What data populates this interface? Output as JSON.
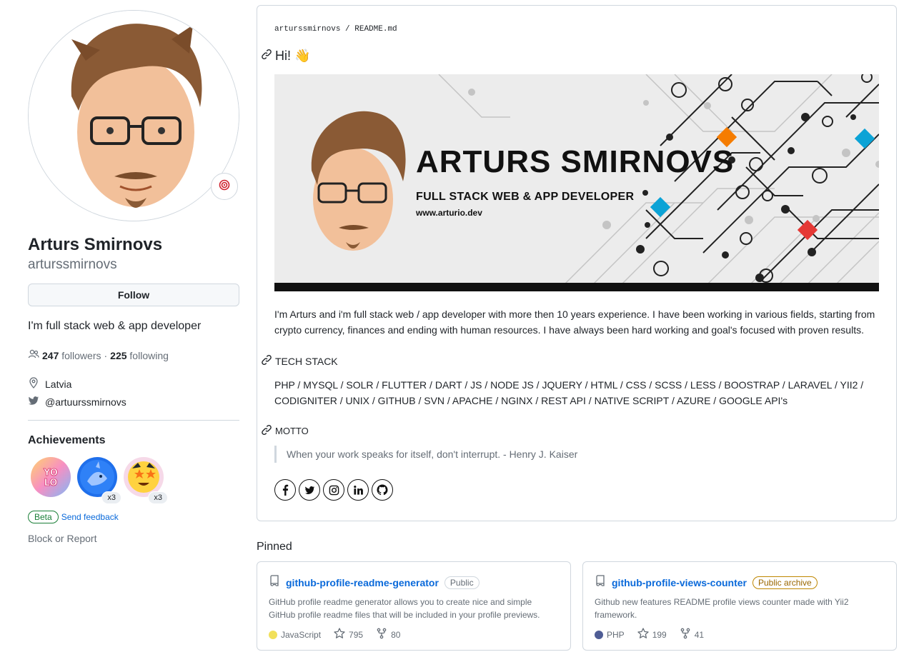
{
  "profile": {
    "full_name": "Arturs Smirnovs",
    "login": "arturssmirnovs",
    "follow_label": "Follow",
    "bio": "I'm full stack web & app developer",
    "followers_count": "247",
    "followers_label": "followers",
    "separator": "·",
    "following_count": "225",
    "following_label": "following",
    "location": "Latvia",
    "twitter": "@artuurssmirnovs"
  },
  "achievements": {
    "title": "Achievements",
    "badges": [
      {
        "name": "YOLO",
        "count": ""
      },
      {
        "name": "Pull Shark",
        "count": "x3"
      },
      {
        "name": "Starstruck",
        "count": "x3"
      }
    ],
    "beta_label": "Beta",
    "feedback_label": "Send feedback"
  },
  "block_report_label": "Block or Report",
  "readme": {
    "owner": "arturssmirnovs",
    "path_sep": "/",
    "filename": "README",
    "ext": ".md",
    "heading_hi": "Hi! 👋",
    "banner": {
      "name": "ARTURS SMIRNOVS",
      "role": "FULL STACK WEB & APP DEVELOPER",
      "site": "www.arturio.dev"
    },
    "intro": "I'm Arturs and i'm full stack web / app developer with more then 10 years experience. I have been working in various fields, starting from crypto currency, finances and ending with human resources. I have always been hard working and goal's focused with proven results.",
    "tech_heading": "TECH STACK",
    "tech_list": "PHP / MYSQL / SOLR / FLUTTER / DART / JS / NODE JS / JQUERY / HTML / CSS / SCSS / LESS / BOOSTRAP / LARAVEL / YII2 / CODIGNITER / UNIX / GITHUB / SVN / APACHE / NGINX / REST API / NATIVE SCRIPT / AZURE / GOOGLE API's",
    "motto_heading": "MOTTO",
    "motto": "When your work speaks for itself, don't interrupt. - Henry J. Kaiser",
    "socials": [
      "facebook-icon",
      "twitter-icon",
      "instagram-icon",
      "linkedin-icon",
      "github-icon"
    ]
  },
  "pinned": {
    "title": "Pinned",
    "repos": [
      {
        "name": "github-profile-readme-generator",
        "visibility": "Public",
        "description": "GitHub profile readme generator allows you to create nice and simple GitHub profile readme files that will be included in your profile previews.",
        "language": "JavaScript",
        "language_color": "#f1e05a",
        "stars": "795",
        "forks": "80"
      },
      {
        "name": "github-profile-views-counter",
        "visibility": "Public archive",
        "description": "Github new features README profile views counter made with Yii2 framework.",
        "language": "PHP",
        "language_color": "#4F5D95",
        "stars": "199",
        "forks": "41"
      }
    ]
  }
}
